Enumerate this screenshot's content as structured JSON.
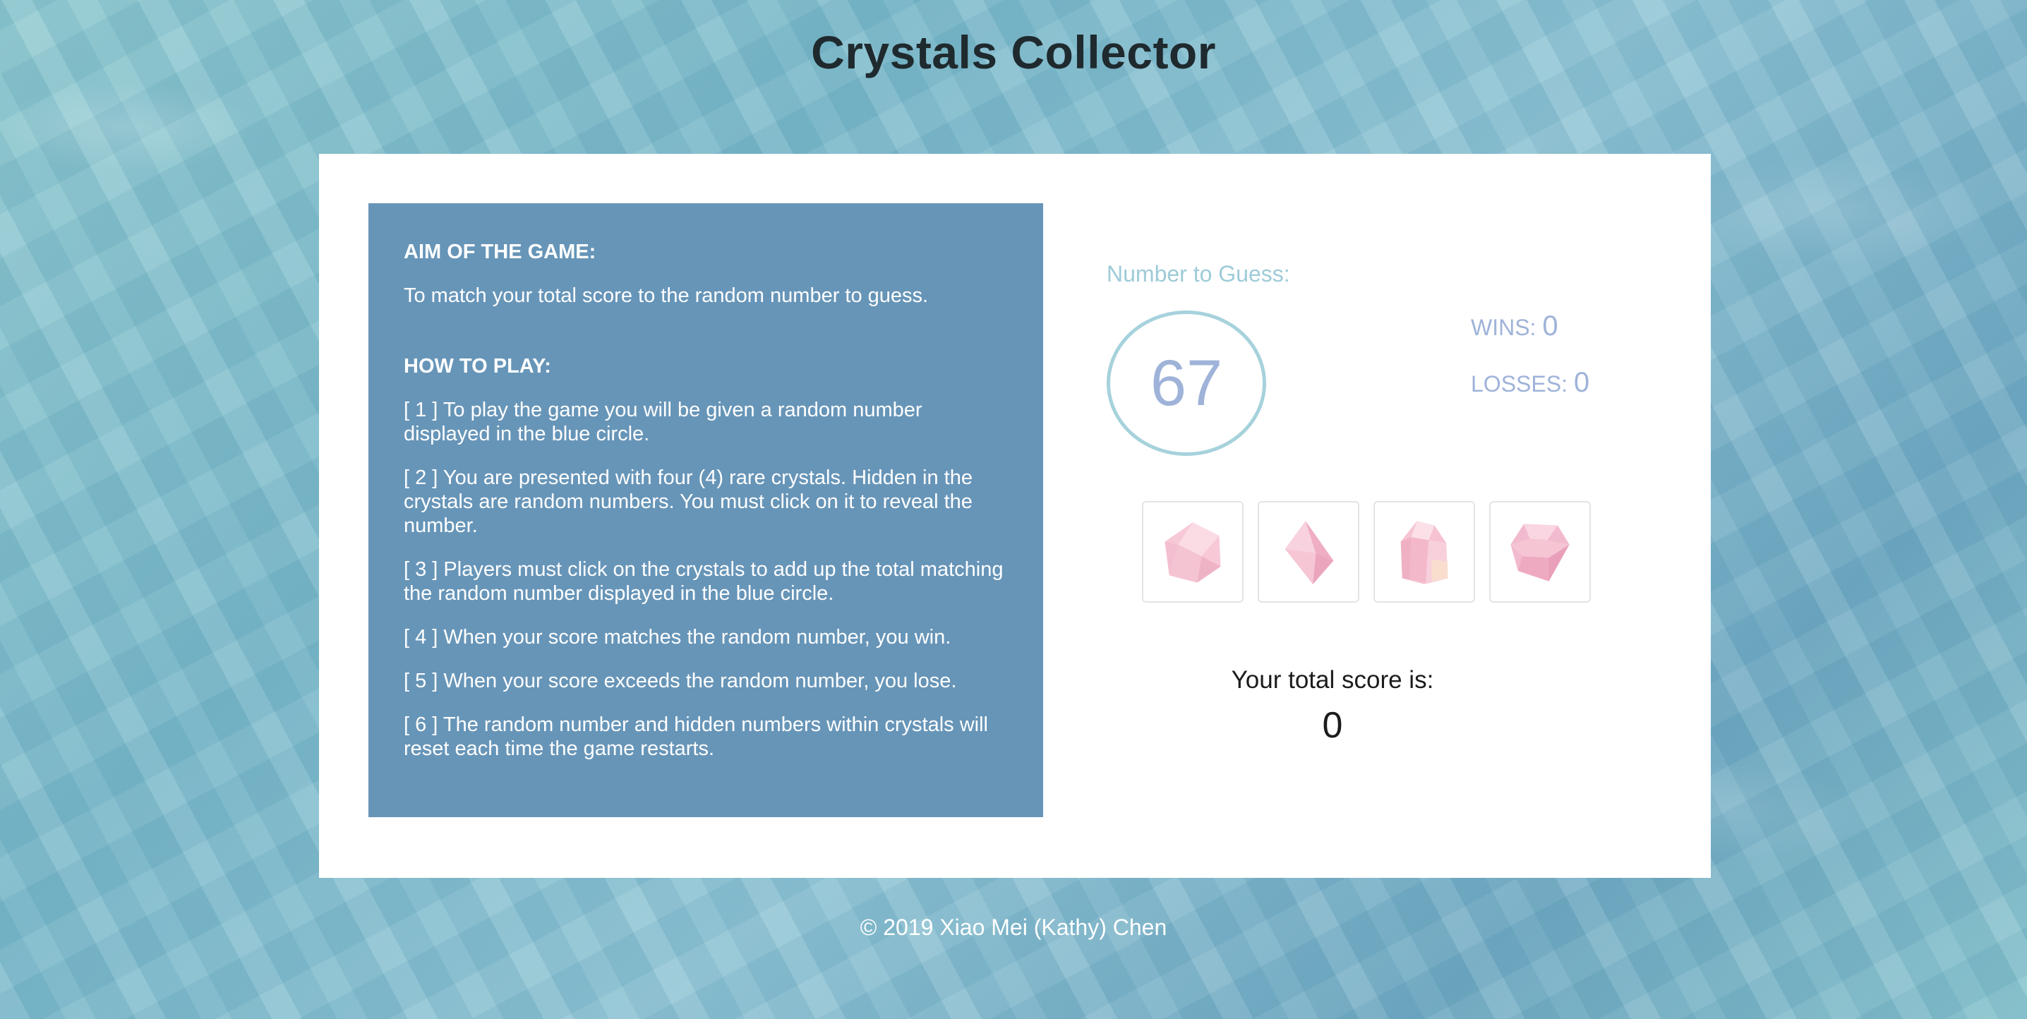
{
  "header": {
    "title": "Crystals Collector"
  },
  "instructions": {
    "aim_heading": "AIM OF THE GAME:",
    "aim_text": "To match your total score to the random number to guess.",
    "how_heading": "HOW TO PLAY:",
    "steps": [
      "[ 1 ] To play the game you will be given a random number displayed in the blue circle.",
      "[ 2 ] You are presented with four (4) rare crystals. Hidden in the crystals are random numbers. You must click on it to reveal the number.",
      "[ 3 ] Players must click on the crystals to add up the total matching the random number displayed in the blue circle.",
      "[ 4 ] When your score matches the random number, you win.",
      "[ 5 ] When your score exceeds the random number, you lose.",
      "[ 6 ] The random number and hidden numbers within crystals will reset each time the game restarts."
    ]
  },
  "game": {
    "guess_label": "Number to Guess:",
    "target_number": "67",
    "wins_label": "WINS:",
    "wins_value": "0",
    "losses_label": "LOSSES:",
    "losses_value": "0",
    "crystals": [
      {
        "icon": "pink-crystal-hexagon-icon",
        "color": "#f4bfd0"
      },
      {
        "icon": "pink-crystal-diamond-icon",
        "color": "#f2b6cc"
      },
      {
        "icon": "pink-crystal-cluster-icon",
        "color": "#f5c2d3"
      },
      {
        "icon": "pink-crystal-gem-icon",
        "color": "#f0b4cb"
      }
    ],
    "score_label": "Your total score is:",
    "score_value": "0"
  },
  "footer": {
    "text": "© 2019 Xiao Mei (Kathy) Chen"
  },
  "colors": {
    "instructions_bg": "#6795b8",
    "circle_border": "#a6d2dc",
    "accent_text": "#9fb3d9",
    "label_text": "#9ecbd8"
  }
}
